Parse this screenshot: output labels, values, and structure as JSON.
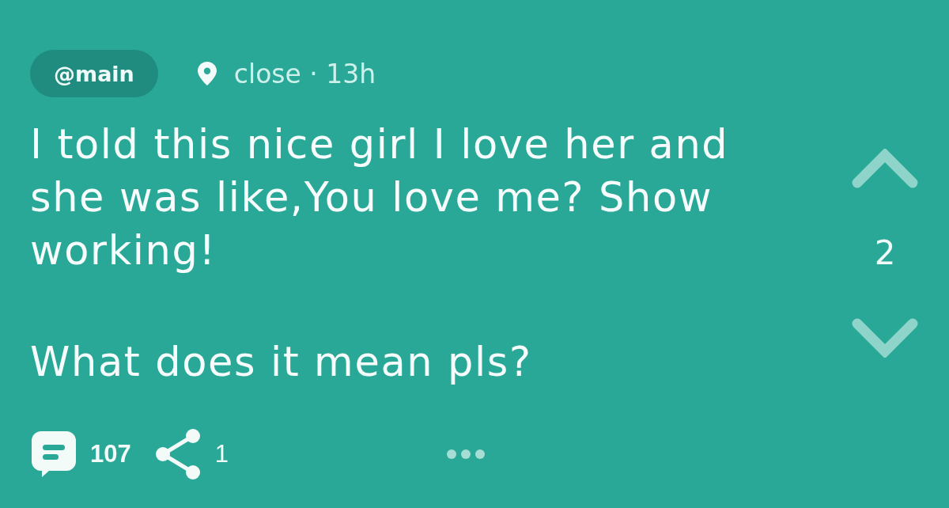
{
  "post": {
    "channel": "@main",
    "meta": "close · 13h",
    "body": [
      "I told this nice girl I love her and she was like,You love me? Show working!",
      "What does it mean pls?"
    ]
  },
  "votes": {
    "score": "2"
  },
  "actions": {
    "comments": "107",
    "shares": "1"
  }
}
